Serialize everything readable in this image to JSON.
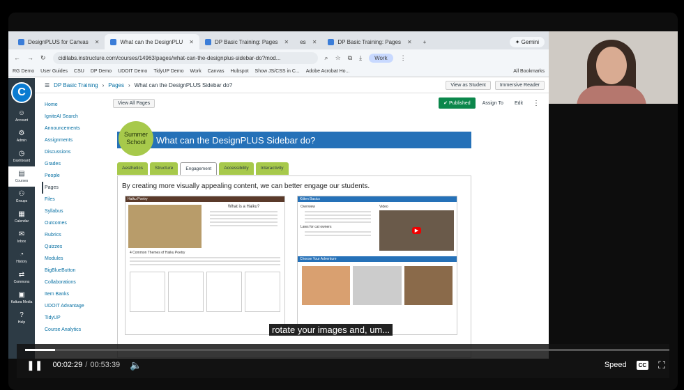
{
  "browser": {
    "tabs": [
      "DesignPLUS for Canvas",
      "What can the DesignPLU",
      "DP Basic Training: Pages",
      "es",
      "DP Basic Training: Pages"
    ],
    "gemini": "✦ Gemini",
    "url": "cidilabs.instructure.com/courses/14963/pages/what-can-the-designplus-sidebar-do?mod...",
    "profile": "Work",
    "bookmarks": [
      "RG Demo",
      "User Guides",
      "CSU",
      "DP Demo",
      "UDOIT Demo",
      "TidyUP Demo",
      "Work",
      "Canvas",
      "Hubspot",
      "Show JS/CSS in C...",
      "Adobe Acrobat Ho...",
      "All Bookmarks"
    ]
  },
  "canvas_nav": [
    {
      "label": "Account",
      "icon": "☺"
    },
    {
      "label": "Admin",
      "icon": "⚙"
    },
    {
      "label": "Dashboard",
      "icon": "◷"
    },
    {
      "label": "Courses",
      "icon": "▤"
    },
    {
      "label": "Groups",
      "icon": "⚇"
    },
    {
      "label": "Calendar",
      "icon": "▦"
    },
    {
      "label": "Inbox",
      "icon": "✉"
    },
    {
      "label": "History",
      "icon": "◔"
    },
    {
      "label": "Commons",
      "icon": "⇄"
    },
    {
      "label": "Kaltura Media",
      "icon": "▣"
    },
    {
      "label": "Help",
      "icon": "?"
    }
  ],
  "breadcrumb": {
    "course": "DP Basic Training",
    "section": "Pages",
    "page": "What can the DesignPLUS Sidebar do?"
  },
  "top_buttons": {
    "student": "View as Student",
    "reader": "Immersive Reader"
  },
  "course_nav": [
    "Home",
    "IgniteAI Search",
    "Announcements",
    "Assignments",
    "Discussions",
    "Grades",
    "People",
    "Pages",
    "Files",
    "Syllabus",
    "Outcomes",
    "Rubrics",
    "Quizzes",
    "Modules",
    "BigBlueButton",
    "Collaborations",
    "Item Banks",
    "UDOIT Advantage",
    "TidyUP",
    "Course Analytics"
  ],
  "page": {
    "view_all": "View All Pages",
    "published": "Published",
    "assign_to": "Assign To",
    "edit": "Edit",
    "badge": "Summer School",
    "title": "What can the DesignPLUS Sidebar do?",
    "tabs": [
      "Aesthetics",
      "Structure",
      "Engagement",
      "Accessibility",
      "Interactivity"
    ],
    "intro": "By creating more visually appealing content, we can better engage our students.",
    "thumb1_title": "Haiku Poetry",
    "thumb1_heading": "What is a Haiku?",
    "thumb1_sub": "4 Common Themes of Haiku Poetry",
    "thumb2_title": "Kitten Basics",
    "thumb2_overview": "Overview",
    "thumb2_video": "Video",
    "thumb2_adventure": "Choose Your Adventure",
    "thumb2_laws": "Laws for cat owners"
  },
  "player": {
    "time_current": "00:02:29",
    "time_sep": "/",
    "time_total": "00:53:39",
    "speed": "Speed",
    "cc": "CC",
    "progress_fraction": 0.046
  },
  "subtitle": "rotate your images and, um..."
}
